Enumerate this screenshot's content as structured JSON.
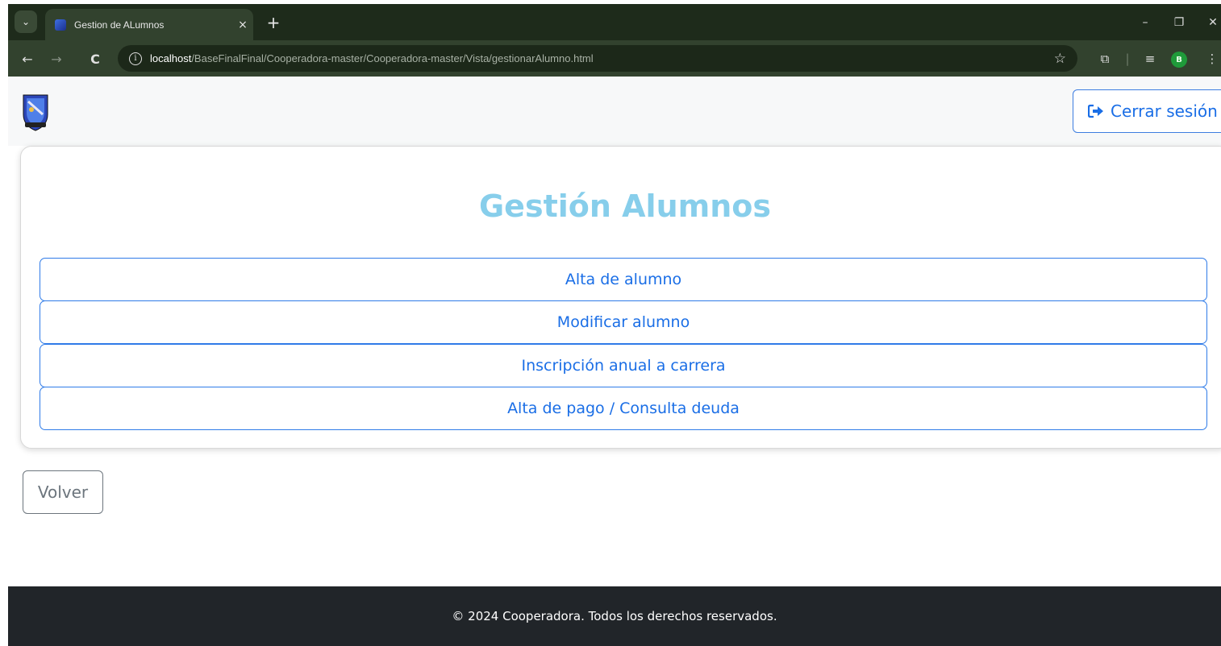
{
  "browser": {
    "tab_title": "Gestion de ALumnos",
    "tab_close": "×",
    "new_tab": "+",
    "url_host": "localhost",
    "url_path": "/BaseFinalFinal/Cooperadora-master/Cooperadora-master/Vista/gestionarAlumno.html",
    "profile_initial": "B",
    "icons": {
      "back": "←",
      "forward": "→",
      "reload": "C",
      "info": "i",
      "star": "☆",
      "minimize": "–",
      "restore": "❐",
      "close": "✕",
      "dropdown": "⌄",
      "extensions": "⧉",
      "media": "≡",
      "menu": "⋮"
    }
  },
  "navbar": {
    "logout_label": "Cerrar sesión"
  },
  "card": {
    "title": "Gestión Alumnos",
    "options": [
      {
        "label": "Alta de alumno"
      },
      {
        "label": "Modificar alumno"
      },
      {
        "label": "Inscripción anual a carrera"
      },
      {
        "label": "Alta de pago / Consulta deuda"
      }
    ]
  },
  "back_label": "Volver",
  "footer": {
    "text": "© 2024 Cooperadora. Todos los derechos reservados."
  },
  "colors": {
    "title": "#87ceeb",
    "primary": "#1a6ee6",
    "footer_bg": "#212529",
    "secondary": "#6c757d"
  }
}
